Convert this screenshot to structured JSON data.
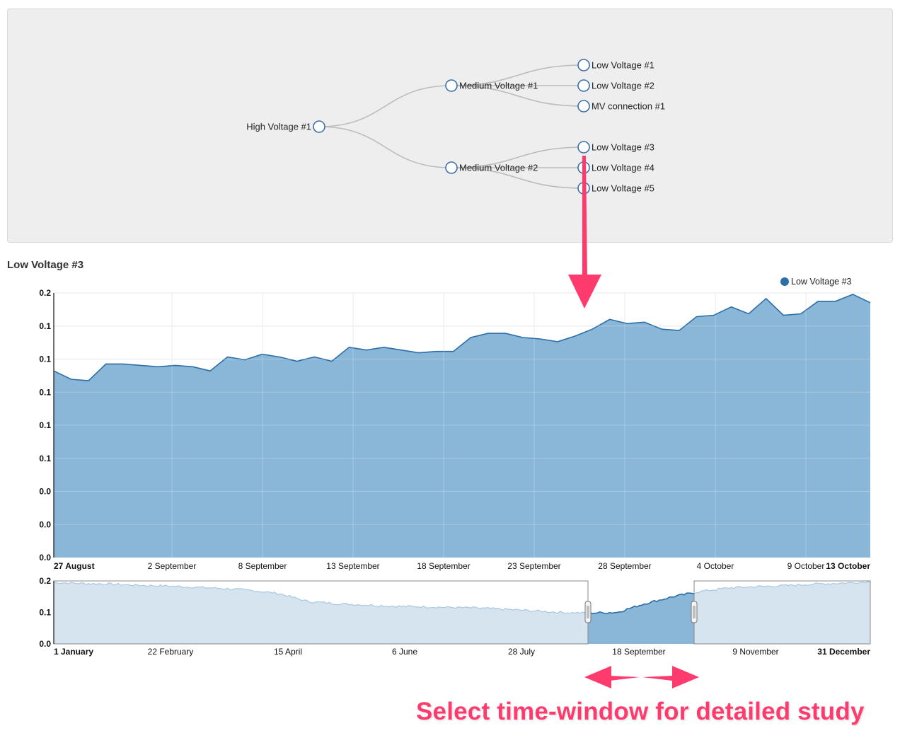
{
  "tree": {
    "nodes": [
      {
        "id": "hv1",
        "label": "High Voltage #1",
        "label_side": "left"
      },
      {
        "id": "mv1",
        "label": "Medium Voltage #1",
        "label_side": "right"
      },
      {
        "id": "mv2",
        "label": "Medium Voltage #2",
        "label_side": "right"
      },
      {
        "id": "lv1",
        "label": "Low Voltage #1",
        "label_side": "right"
      },
      {
        "id": "lv2",
        "label": "Low Voltage #2",
        "label_side": "right"
      },
      {
        "id": "mvc1",
        "label": "MV connection #1",
        "label_side": "right"
      },
      {
        "id": "lv3",
        "label": "Low Voltage #3",
        "label_side": "right"
      },
      {
        "id": "lv4",
        "label": "Low Voltage #4",
        "label_side": "right"
      },
      {
        "id": "lv5",
        "label": "Low Voltage #5",
        "label_side": "right"
      }
    ],
    "links": [
      [
        "hv1",
        "mv1"
      ],
      [
        "hv1",
        "mv2"
      ],
      [
        "mv1",
        "lv1"
      ],
      [
        "mv1",
        "lv2"
      ],
      [
        "mv1",
        "mvc1"
      ],
      [
        "mv2",
        "lv3"
      ],
      [
        "mv2",
        "lv4"
      ],
      [
        "mv2",
        "lv5"
      ]
    ],
    "selected": "lv3"
  },
  "section_title": "Low Voltage #3",
  "colors": {
    "area": "#8ab6d8",
    "line": "#2b6ea8",
    "context_area": "#d6e4f0",
    "context_line": "#a9c7e0",
    "grid": "#e2e2e2",
    "annotation": "#ff3b6e",
    "node_stroke": "#3a6fa8",
    "link": "#bbbbbb"
  },
  "chart_data": [
    {
      "type": "area",
      "title": "",
      "series": [
        {
          "name": "Low Voltage #3"
        }
      ],
      "legend": {
        "position": "top-right",
        "label": "Low Voltage #3"
      },
      "y_tick_labels": [
        "0.0",
        "0.0",
        "0.0",
        "0.1",
        "0.1",
        "0.1",
        "0.1",
        "0.1",
        "0.2"
      ],
      "x_tick_labels": [
        "27 August",
        "2 September",
        "8 September",
        "13 September",
        "18 September",
        "23 September",
        "28 September",
        "4 October",
        "9 October",
        "13 October"
      ],
      "x_tick_bold": [
        true,
        false,
        false,
        false,
        false,
        false,
        false,
        false,
        false,
        true
      ],
      "x_range": [
        "27 August",
        "13 October"
      ],
      "ylim": [
        0,
        0.19
      ],
      "grid": true,
      "values": [
        0.134,
        0.128,
        0.127,
        0.139,
        0.139,
        0.138,
        0.137,
        0.138,
        0.137,
        0.134,
        0.144,
        0.142,
        0.146,
        0.144,
        0.141,
        0.144,
        0.141,
        0.151,
        0.149,
        0.151,
        0.149,
        0.147,
        0.148,
        0.148,
        0.158,
        0.161,
        0.161,
        0.158,
        0.157,
        0.155,
        0.159,
        0.164,
        0.171,
        0.168,
        0.169,
        0.164,
        0.163,
        0.173,
        0.174,
        0.18,
        0.175,
        0.186,
        0.174,
        0.175,
        0.184,
        0.184,
        0.189,
        0.183
      ]
    },
    {
      "type": "area",
      "title": "",
      "role": "context-brush",
      "y_tick_labels": [
        "0.0",
        "0.1",
        "0.2"
      ],
      "x_tick_labels": [
        "1 January",
        "22 February",
        "15 April",
        "6 June",
        "28 July",
        "18 September",
        "9 November",
        "31 December"
      ],
      "x_tick_bold": [
        true,
        false,
        false,
        false,
        false,
        false,
        false,
        true
      ],
      "x_range": [
        "1 January",
        "31 December"
      ],
      "ylim": [
        0,
        0.2
      ],
      "brush_range": [
        "27 August",
        "13 October"
      ],
      "anchor_values": [
        0.195,
        0.192,
        0.19,
        0.186,
        0.184,
        0.18,
        0.176,
        0.17,
        0.16,
        0.135,
        0.128,
        0.124,
        0.12,
        0.118,
        0.116,
        0.114,
        0.11,
        0.105,
        0.1,
        0.098,
        0.1,
        0.128,
        0.15,
        0.167,
        0.178,
        0.182,
        0.185,
        0.19,
        0.193,
        0.198
      ]
    }
  ],
  "annotation": {
    "text": "Select time-window for detailed study"
  }
}
